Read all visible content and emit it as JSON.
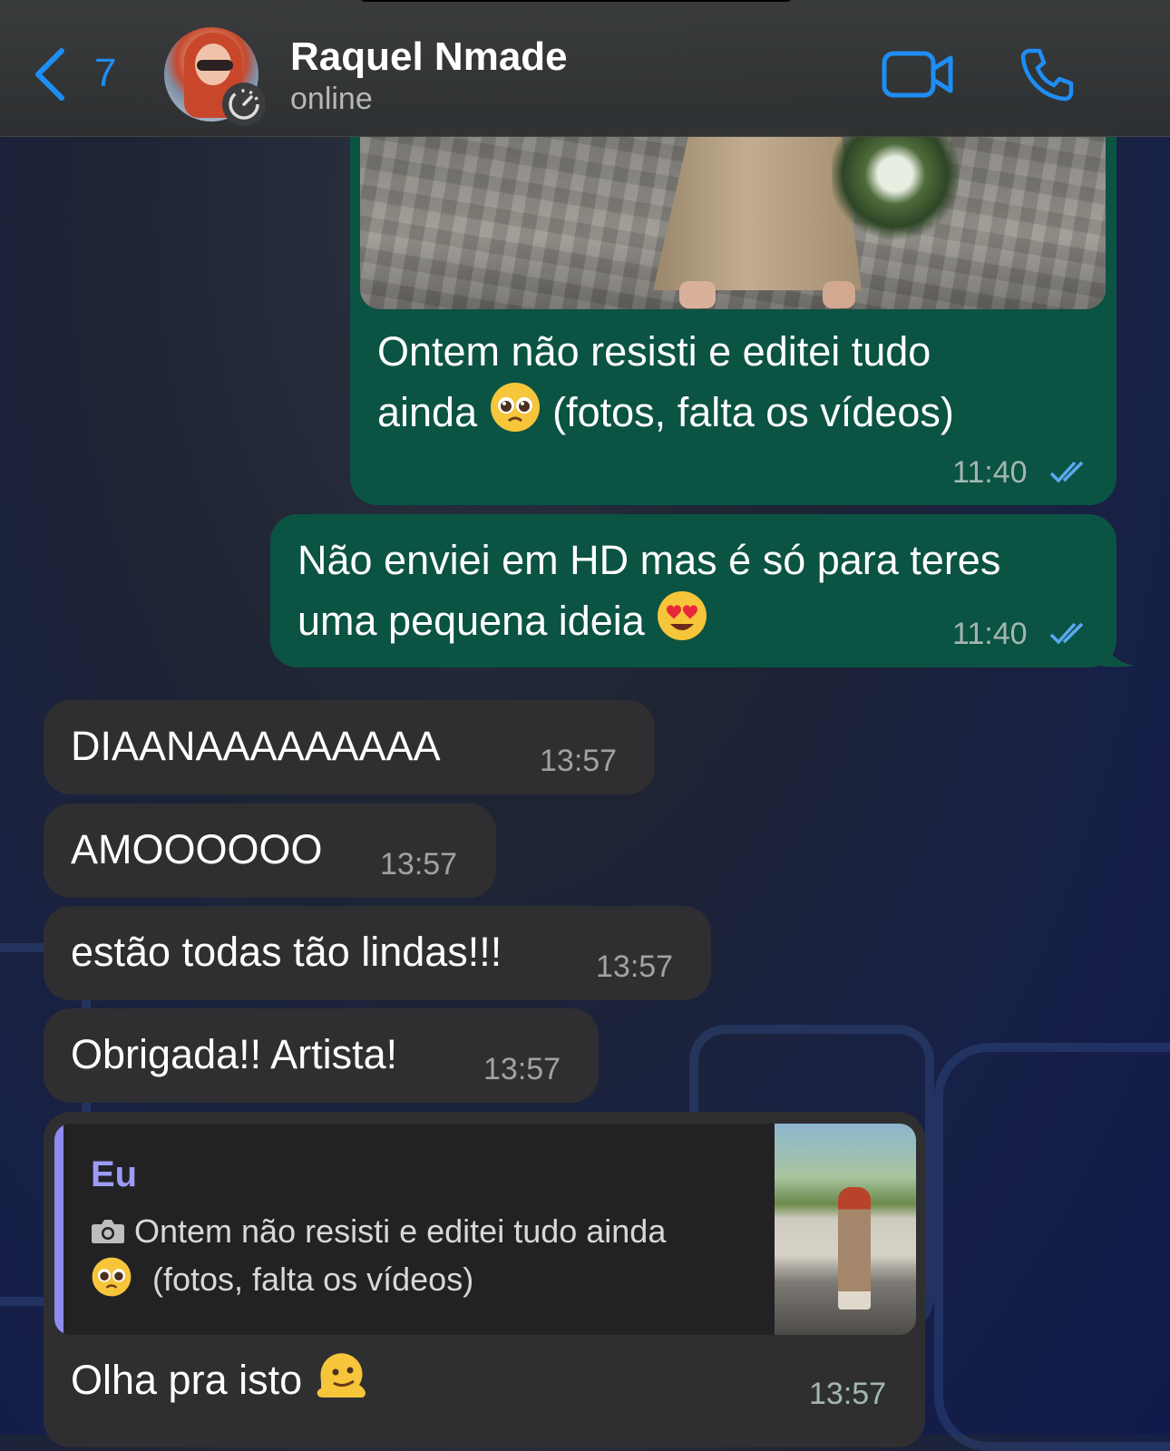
{
  "header": {
    "back_count": "7",
    "contact_name": "Raquel Nmade",
    "status": "online",
    "icons": {
      "back": "chevron-left-icon",
      "timer": "disappearing-timer-icon",
      "video": "video-camera-icon",
      "call": "phone-icon"
    },
    "accent_color": "#1e8ef4"
  },
  "messages": [
    {
      "text_line1": "Ontem não resisti e editei tudo",
      "text_line2a": "ainda",
      "text_line2b": "(fotos, falta os vídeos)",
      "time": "11:40"
    },
    {
      "text_line1": "Não enviei em HD mas é só para teres",
      "text_line2": "uma pequena ideia",
      "time": "11:40"
    },
    {
      "text": "DIAANAAAAAAAAA",
      "time": "13:57"
    },
    {
      "text": "AMOOOOOO",
      "time": "13:57"
    },
    {
      "text": "estão todas tão lindas!!!",
      "time": "13:57"
    },
    {
      "text": "Obrigada!! Artista!",
      "time": "13:57"
    },
    {
      "quote_author": "Eu",
      "quote_line1": "Ontem não resisti e editei tudo ainda",
      "quote_line2": "(fotos, falta os vídeos)",
      "text": "Olha pra isto",
      "time": "13:57"
    }
  ],
  "colors": {
    "outgoing_bubble": "#0b5343",
    "incoming_bubble": "#2f2f31",
    "read_ticks": "#5aa9f2",
    "quote_bar": "#8e8cf0"
  }
}
